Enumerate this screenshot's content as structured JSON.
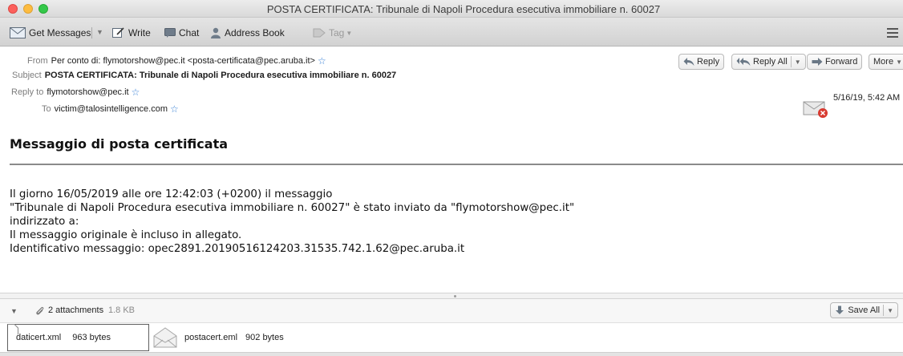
{
  "window": {
    "title": "POSTA CERTIFICATA: Tribunale di Napoli Procedura esecutiva immobiliare n. 60027"
  },
  "toolbar": {
    "get_messages": "Get Messages",
    "write": "Write",
    "chat": "Chat",
    "address_book": "Address Book",
    "tag": "Tag"
  },
  "header": {
    "from_label": "From",
    "from_value": "Per conto di: flymotorshow@pec.it <posta-certificata@pec.aruba.it>",
    "subject_label": "Subject",
    "subject_value": "POSTA CERTIFICATA: Tribunale di Napoli Procedura esecutiva immobiliare n. 60027",
    "replyto_label": "Reply to",
    "replyto_value": "flymotorshow@pec.it",
    "to_label": "To",
    "to_value": "victim@talosintelligence.com",
    "date": "5/16/19, 5:42 AM",
    "buttons": {
      "reply": "Reply",
      "reply_all": "Reply All",
      "forward": "Forward",
      "more": "More"
    }
  },
  "body": {
    "heading": "Messaggio di posta certificata",
    "lines": [
      "Il giorno 16/05/2019 alle ore 12:42:03 (+0200) il messaggio",
      "\"Tribunale di Napoli Procedura esecutiva immobiliare n. 60027\" è stato inviato da \"flymotorshow@pec.it\"",
      "indirizzato a:",
      "Il messaggio originale è incluso in allegato.",
      "Identificativo messaggio: opec2891.20190516124203.31535.742.1.62@pec.aruba.it"
    ]
  },
  "attachments": {
    "count_label": "2 attachments",
    "total_size": "1.8 KB",
    "save_all": "Save All",
    "items": [
      {
        "name": "daticert.xml",
        "size": "963 bytes"
      },
      {
        "name": "postacert.eml",
        "size": "902 bytes"
      }
    ]
  },
  "colors": {
    "star": "#3b82d6",
    "close": "#fc605c",
    "minimize": "#fdbc40",
    "maximize": "#34c84a",
    "envelope_badge": "#d83a30"
  }
}
